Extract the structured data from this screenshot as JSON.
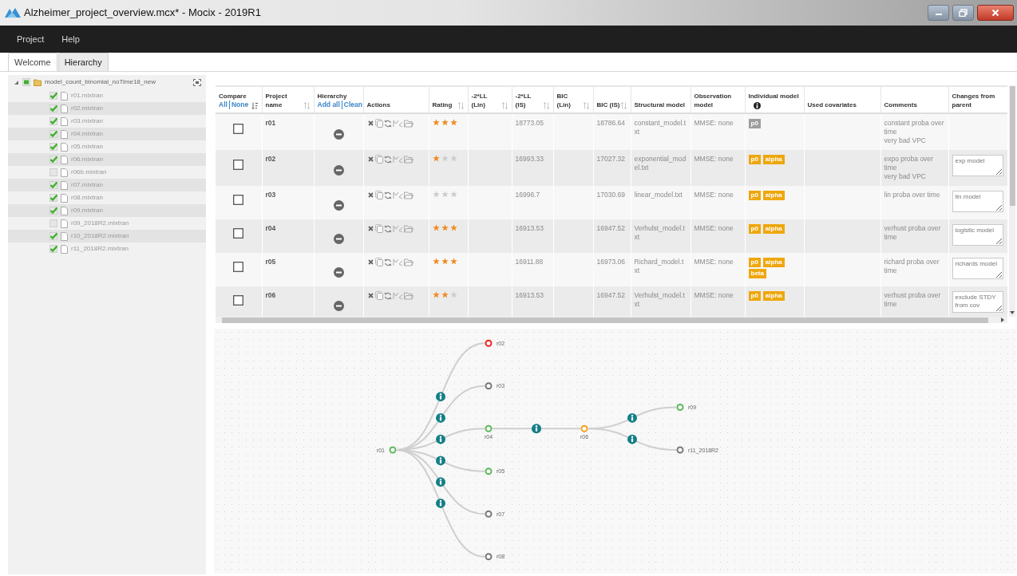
{
  "window": {
    "title": "Alzheimer_project_overview.mcx* - Mocix - 2019R1"
  },
  "menu": [
    {
      "label": "Project"
    },
    {
      "label": "Help"
    }
  ],
  "tabs": [
    {
      "label": "Welcome",
      "selected": false
    },
    {
      "label": "Hierarchy",
      "selected": true
    }
  ],
  "project_tree": {
    "label": "model_count_binomial_noTime18_new",
    "expanded": true,
    "partially_checked": true,
    "children": [
      {
        "label": "r01.mixtran",
        "checked": true
      },
      {
        "label": "r02.mixtran",
        "checked": true
      },
      {
        "label": "r03.mixtran",
        "checked": true
      },
      {
        "label": "r04.mixtran",
        "checked": true
      },
      {
        "label": "r05.mixtran",
        "checked": true
      },
      {
        "label": "r06.mixtran",
        "checked": true
      },
      {
        "label": "r06b.mixtran",
        "checked": false
      },
      {
        "label": "r07.mixtran",
        "checked": true
      },
      {
        "label": "r08.mixtran",
        "checked": true
      },
      {
        "label": "r09.mixtran",
        "checked": true
      },
      {
        "label": "r09_2018R2.mixtran",
        "checked": false
      },
      {
        "label": "r10_2018R2.mixtran",
        "checked": true
      },
      {
        "label": "r11_2018R2.mixtran",
        "checked": true
      }
    ]
  },
  "table": {
    "columns": [
      {
        "label": "Compare",
        "links": [
          "All",
          "None"
        ],
        "sortable": true,
        "sorted": true
      },
      {
        "label": "Project name",
        "sortable": true,
        "sorted": false
      },
      {
        "label": "Hierarchy",
        "links": [
          "Add all",
          "Clean"
        ]
      },
      {
        "label": "Actions"
      },
      {
        "label": "Rating",
        "sortable": true,
        "sorted": false
      },
      {
        "label": "-2*LL (Lin)",
        "sortable": true,
        "sorted": false
      },
      {
        "label": "-2*LL (IS)",
        "sortable": true,
        "sorted": false
      },
      {
        "label": "BIC (Lin)",
        "sortable": true,
        "sorted": false
      },
      {
        "label": "BIC (IS)",
        "sortable": true,
        "sorted": false
      },
      {
        "label": "Structural model"
      },
      {
        "label": "Observation model"
      },
      {
        "label": "Individual model",
        "info": true
      },
      {
        "label": "Used covariates"
      },
      {
        "label": "Comments"
      },
      {
        "label": "Changes from parent"
      }
    ],
    "rows": [
      {
        "name": "r01",
        "compared": false,
        "stars": 3,
        "ll_is": "18773.05",
        "bic_is": "18786.64",
        "structural_model": "constant_model.txt",
        "observation_model": "MMSE: none",
        "individual_model": [
          {
            "label": "p0",
            "color": "#9e9e9e"
          }
        ],
        "comments": "constant proba over time\nvery bad VPC"
      },
      {
        "name": "r02",
        "compared": false,
        "stars": 1,
        "ll_is": "16993.33",
        "bic_is": "17027.32",
        "structural_model": "exponential_model.txt",
        "observation_model": "MMSE: none",
        "individual_model": [
          {
            "label": "p0",
            "color": "#eea70d"
          },
          {
            "label": "alpha",
            "color": "#eea70d"
          }
        ],
        "comments": "expo proba over time\nvery bad VPC",
        "changes": "exp model"
      },
      {
        "name": "r03",
        "compared": false,
        "stars": 0,
        "ll_is": "16996.7",
        "bic_is": "17030.69",
        "structural_model": "linear_model.txt",
        "observation_model": "MMSE: none",
        "individual_model": [
          {
            "label": "p0",
            "color": "#eea70d"
          },
          {
            "label": "alpha",
            "color": "#eea70d"
          }
        ],
        "comments": "lin proba over time",
        "changes": "lin model"
      },
      {
        "name": "r04",
        "compared": false,
        "stars": 3,
        "ll_is": "16913.53",
        "bic_is": "16947.52",
        "structural_model": "Verhulst_model.txt",
        "observation_model": "MMSE: none",
        "individual_model": [
          {
            "label": "p0",
            "color": "#eea70d"
          },
          {
            "label": "alpha",
            "color": "#eea70d"
          }
        ],
        "comments": "verhust proba over time",
        "changes": "logistic model"
      },
      {
        "name": "r05",
        "compared": false,
        "stars": 3,
        "ll_is": "16911.88",
        "bic_is": "16973.06",
        "structural_model": "Richard_model.txt",
        "observation_model": "MMSE: none",
        "individual_model": [
          {
            "label": "p0",
            "color": "#eea70d"
          },
          {
            "label": "alpha",
            "color": "#eea70d"
          },
          {
            "label": "beta",
            "color": "#eea70d"
          }
        ],
        "comments": "richard proba over time",
        "changes": "richards model"
      },
      {
        "name": "r06",
        "compared": false,
        "stars": 2,
        "ll_is": "16913.53",
        "bic_is": "16947.52",
        "structural_model": "Verhulst_model.txt",
        "observation_model": "MMSE: none",
        "individual_model": [
          {
            "label": "p0",
            "color": "#eea70d"
          },
          {
            "label": "alpha",
            "color": "#eea70d"
          }
        ],
        "comments": "verhust proba over time",
        "changes": "exclude STDY from cov"
      }
    ]
  },
  "hierarchy_graph": {
    "root": {
      "label": "r01",
      "color": "#5cb85c",
      "children": [
        {
          "label": "r02",
          "color": "#e8251f"
        },
        {
          "label": "r03",
          "color": "#777777"
        },
        {
          "label": "r04",
          "color": "#5cb85c",
          "children": [
            {
              "label": "r06",
              "color": "#f5a21b",
              "children": [
                {
                  "label": "r09",
                  "color": "#5cb85c"
                },
                {
                  "label": "r11_2018R2",
                  "color": "#777777"
                }
              ]
            }
          ]
        },
        {
          "label": "r05",
          "color": "#5cb85c"
        },
        {
          "label": "r07",
          "color": "#777777"
        },
        {
          "label": "r08",
          "color": "#777777"
        }
      ]
    }
  }
}
